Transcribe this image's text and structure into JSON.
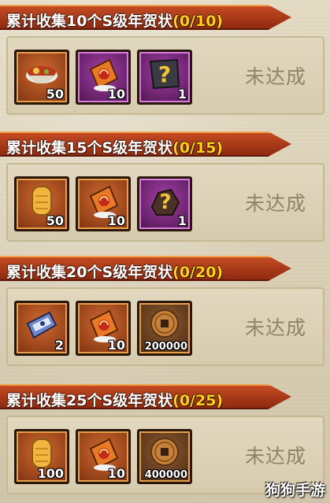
{
  "tiers": [
    {
      "title": "累计收集10个S级年贺状",
      "progress": "(0/10)",
      "status": "未达成",
      "rewards": [
        {
          "icon": "ramen-bowl-icon",
          "qty": "50",
          "frame": "orange"
        },
        {
          "icon": "new-year-card-icon",
          "qty": "10",
          "frame": "purple"
        },
        {
          "icon": "mystery-shuriken-icon",
          "qty": "1",
          "frame": "purple"
        }
      ]
    },
    {
      "title": "累计收集15个S级年贺状",
      "progress": "(0/15)",
      "status": "未达成",
      "rewards": [
        {
          "icon": "gold-bar-icon",
          "qty": "50",
          "frame": "orange"
        },
        {
          "icon": "new-year-card-icon",
          "qty": "10",
          "frame": "orange"
        },
        {
          "icon": "mystery-rock-icon",
          "qty": "1",
          "frame": "purple"
        }
      ]
    },
    {
      "title": "累计收集20个S级年贺状",
      "progress": "(0/20)",
      "status": "未达成",
      "rewards": [
        {
          "icon": "ticket-icon",
          "qty": "2",
          "frame": "orange"
        },
        {
          "icon": "new-year-card-icon",
          "qty": "10",
          "frame": "orange"
        },
        {
          "icon": "copper-coin-icon",
          "qty": "200000",
          "frame": "brown"
        }
      ]
    },
    {
      "title": "累计收集25个S级年贺状",
      "progress": "(0/25)",
      "status": "未达成",
      "rewards": [
        {
          "icon": "gold-bar-icon",
          "qty": "100",
          "frame": "orange"
        },
        {
          "icon": "new-year-card-icon",
          "qty": "10",
          "frame": "orange"
        },
        {
          "icon": "copper-coin-icon",
          "qty": "400000",
          "frame": "brown"
        }
      ]
    }
  ],
  "watermark": "狗狗手游"
}
